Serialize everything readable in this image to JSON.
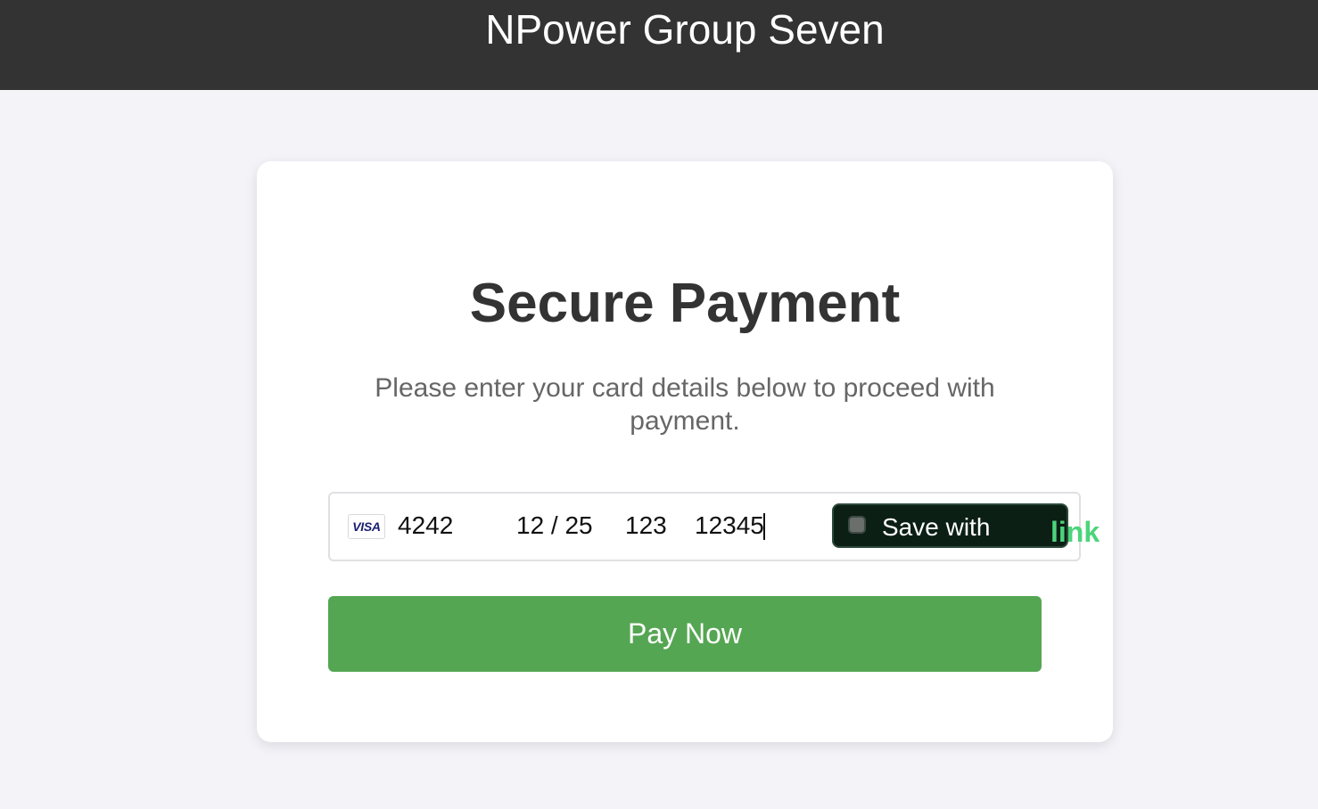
{
  "header": {
    "title": "NPower Group Seven",
    "background": "#333333"
  },
  "payment": {
    "title": "Secure Payment",
    "subtitle": "Please enter your card details below to proceed with payment.",
    "card_brand": "VISA",
    "card_number": "4242",
    "expiry": "12 / 25",
    "cvc": "123",
    "postal_code": "12345",
    "save_with_label": "Save with",
    "save_with_brand": "link",
    "save_with_checked": false,
    "pay_button_label": "Pay Now"
  },
  "colors": {
    "page_background": "#f3f3f8",
    "pay_button": "#55a653",
    "link_button": "#0c1f15",
    "link_brand": "#4cd47a"
  },
  "icons": {
    "card_brand_icon": "visa-icon",
    "save_checkbox": "checkbox-icon"
  }
}
